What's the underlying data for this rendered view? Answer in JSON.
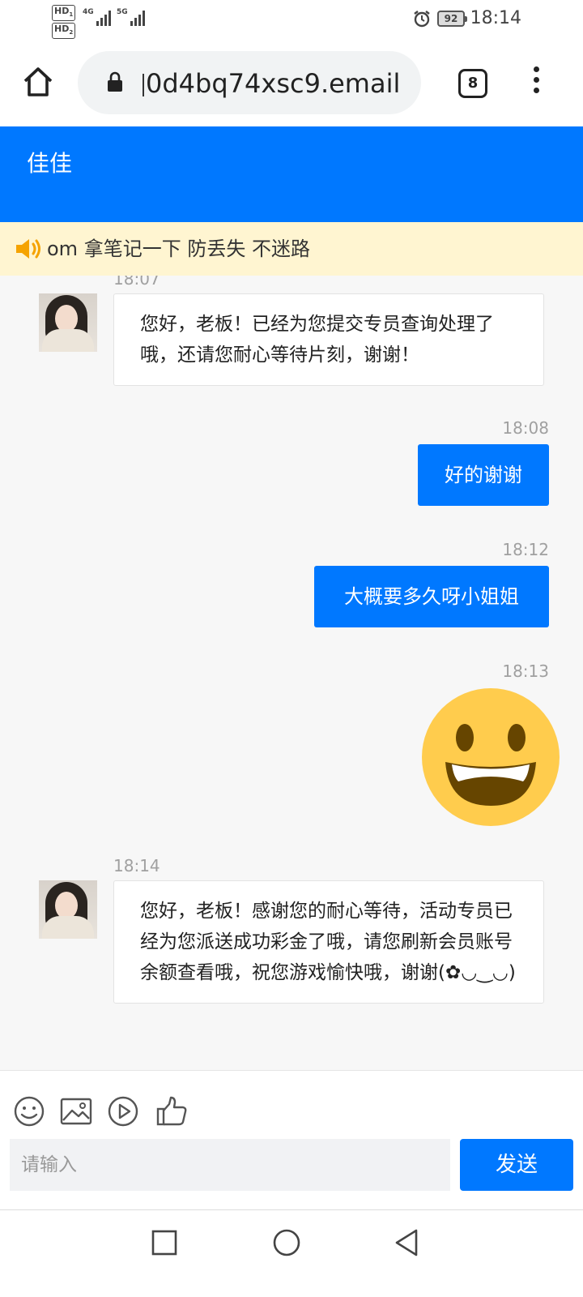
{
  "status_bar": {
    "time": "18:14",
    "battery": "92",
    "hd1": "HD",
    "hd1_sub": "1",
    "hd2": "HD",
    "hd2_sub": "2",
    "network1": "4G",
    "network2": "5G"
  },
  "browser": {
    "url": "0d4bq74xsc9.email",
    "tab_count": "8"
  },
  "chat": {
    "agent_name": "佳佳",
    "notice": "om 拿笔记一下 防丢失 不迷路",
    "messages": [
      {
        "time": "18:07",
        "direction": "incoming",
        "type": "text",
        "text": "您好，老板！已经为您提交专员查询处理了哦，还请您耐心等待片刻，谢谢！"
      },
      {
        "time": "18:08",
        "direction": "outgoing",
        "type": "text",
        "text": "好的谢谢"
      },
      {
        "time": "18:12",
        "direction": "outgoing",
        "type": "text",
        "text": "大概要多久呀小姐姐"
      },
      {
        "time": "18:13",
        "direction": "outgoing",
        "type": "emoji",
        "icon": "grinning-face-emoji"
      },
      {
        "time": "18:14",
        "direction": "incoming",
        "type": "text",
        "text": "您好，老板！感谢您的耐心等待，活动专员已经为您派送成功彩金了哦，请您刷新会员账号余额查看哦，祝您游戏愉快哦，谢谢(✿◡‿◡)"
      }
    ]
  },
  "input": {
    "placeholder": "请输入",
    "send_label": "发送",
    "tools": [
      "emoji-icon",
      "image-icon",
      "video-icon",
      "thumbs-up-icon"
    ]
  },
  "colors": {
    "accent": "#0078ff",
    "notice_bg": "#fff5d1",
    "emoji_yellow": "#ffcc4d"
  }
}
